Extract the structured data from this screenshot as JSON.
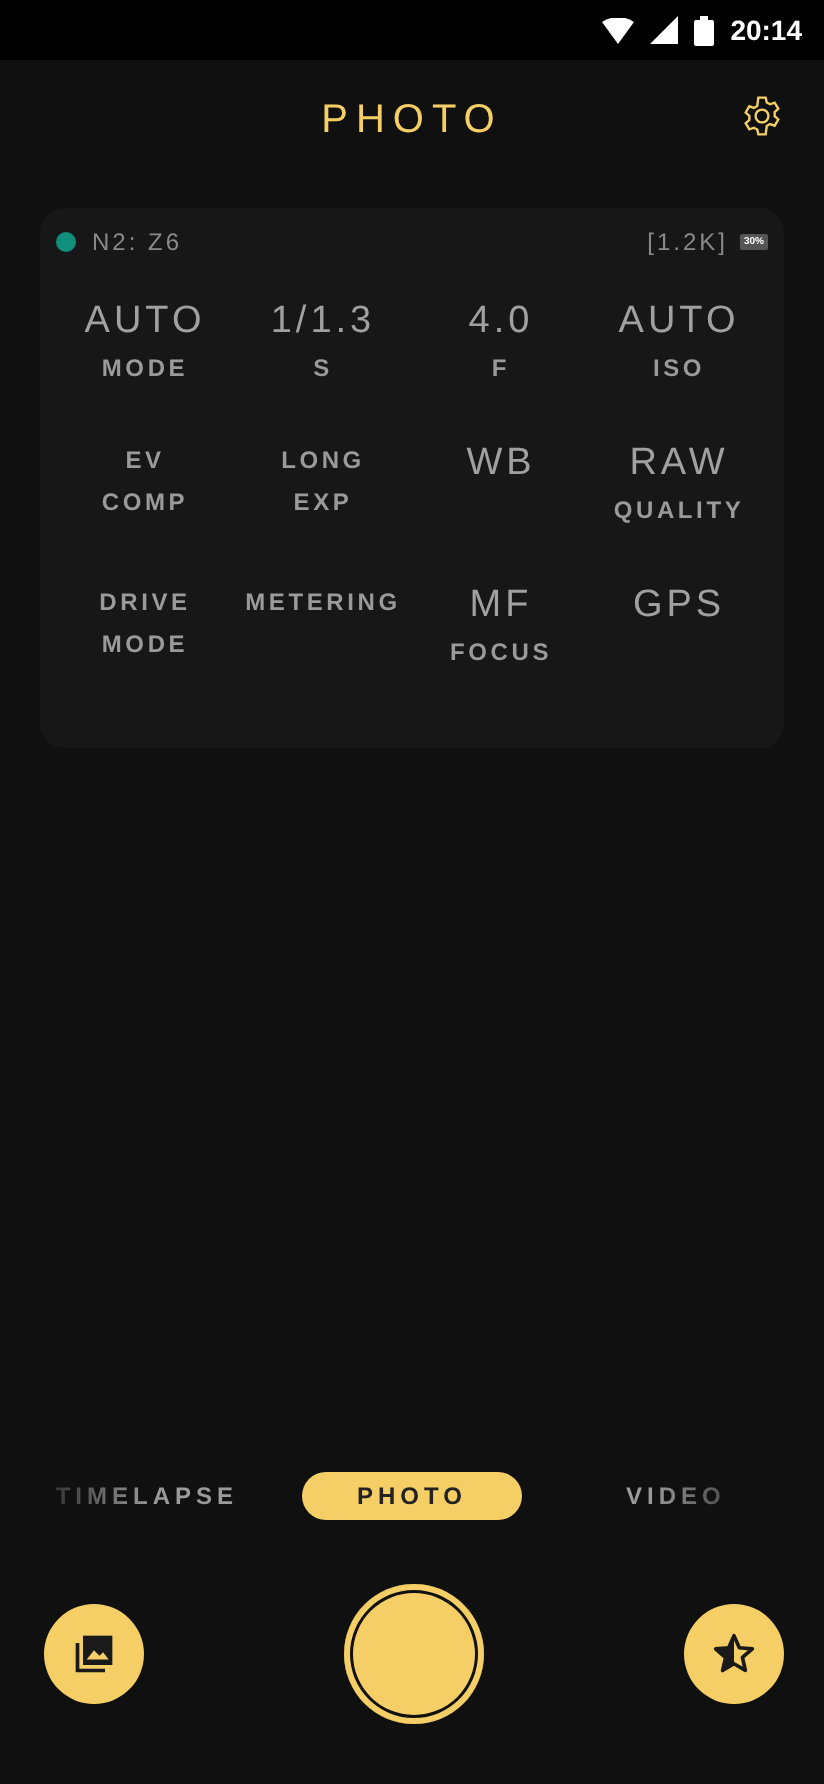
{
  "status_bar": {
    "time": "20:14"
  },
  "header": {
    "title": "PHOTO"
  },
  "camera": {
    "name": "N2: Z6",
    "color": "#0f8f7c",
    "remaining": "[1.2K]",
    "battery": "30%"
  },
  "settings": [
    {
      "lines": [
        {
          "kind": "value",
          "text": "AUTO"
        },
        {
          "kind": "label",
          "text": "MODE"
        }
      ]
    },
    {
      "lines": [
        {
          "kind": "value",
          "text": "1/1.3"
        },
        {
          "kind": "label",
          "text": "S"
        }
      ]
    },
    {
      "lines": [
        {
          "kind": "value",
          "text": "4.0"
        },
        {
          "kind": "label",
          "text": "F"
        }
      ]
    },
    {
      "lines": [
        {
          "kind": "value",
          "text": "AUTO"
        },
        {
          "kind": "label",
          "text": "ISO"
        }
      ]
    },
    {
      "lines": [
        {
          "kind": "label",
          "text": "EV"
        },
        {
          "kind": "label",
          "text": "COMP"
        }
      ]
    },
    {
      "lines": [
        {
          "kind": "label",
          "text": "LONG"
        },
        {
          "kind": "label",
          "text": "EXP"
        }
      ]
    },
    {
      "lines": [
        {
          "kind": "value",
          "text": "WB"
        }
      ]
    },
    {
      "lines": [
        {
          "kind": "value",
          "text": "RAW"
        },
        {
          "kind": "label",
          "text": "QUALITY"
        }
      ]
    },
    {
      "lines": [
        {
          "kind": "label",
          "text": "DRIVE"
        },
        {
          "kind": "label",
          "text": "MODE"
        }
      ]
    },
    {
      "lines": [
        {
          "kind": "label",
          "text": "METERING"
        }
      ]
    },
    {
      "lines": [
        {
          "kind": "value",
          "text": "MF"
        },
        {
          "kind": "label",
          "text": "FOCUS"
        }
      ]
    },
    {
      "lines": [
        {
          "kind": "value",
          "text": "GPS"
        }
      ]
    }
  ],
  "modes": [
    {
      "label": "TIMELAPSE",
      "selected": false
    },
    {
      "label": "PHOTO",
      "selected": true
    },
    {
      "label": "VIDEO",
      "selected": false
    }
  ]
}
